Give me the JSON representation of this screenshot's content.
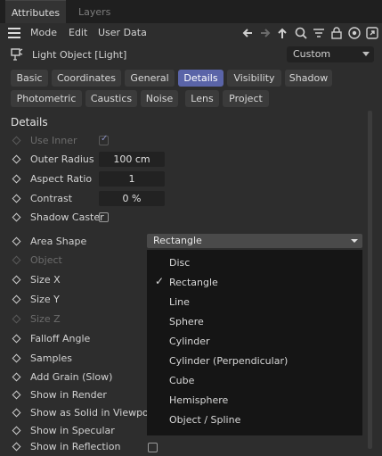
{
  "tabs": {
    "active": "Attributes",
    "inactive": "Layers"
  },
  "menu": {
    "mode": "Mode",
    "edit": "Edit",
    "user_data": "User Data"
  },
  "toolbar_icons": [
    "arrow-left-icon",
    "arrow-right-icon",
    "arrow-up-icon",
    "search-icon",
    "filter-icon",
    "lock-icon",
    "target-icon",
    "expand-icon"
  ],
  "object": {
    "title": "Light Object [Light]",
    "mode_value": "Custom"
  },
  "property_tabs": [
    "Basic",
    "Coordinates",
    "General",
    "Details",
    "Visibility",
    "Shadow",
    "Photometric",
    "Caustics",
    "Noise",
    "Lens",
    "Project"
  ],
  "active_tab": "Details",
  "section_title": "Details",
  "params": {
    "use_inner": "Use Inner",
    "outer_radius": "Outer Radius",
    "outer_radius_value": "100 cm",
    "aspect_ratio": "Aspect Ratio",
    "aspect_ratio_value": "1",
    "contrast": "Contrast",
    "contrast_value": "0 %",
    "shadow_caster": "Shadow Caster",
    "area_shape": "Area Shape",
    "object": "Object",
    "size_x": "Size X",
    "size_y": "Size Y",
    "size_z": "Size Z",
    "falloff_angle": "Falloff Angle",
    "samples": "Samples",
    "add_grain": "Add Grain (Slow)",
    "show_in_render": "Show in Render",
    "show_as_solid": "Show as Solid in Viewport",
    "show_in_specular": "Show in Specular",
    "show_in_reflection": "Show in Reflection"
  },
  "area_shape": {
    "selected": "Rectangle",
    "options": [
      "Disc",
      "Rectangle",
      "Line",
      "Sphere",
      "Cylinder",
      "Cylinder (Perpendicular)",
      "Cube",
      "Hemisphere",
      "Object / Spline"
    ]
  },
  "colors": {
    "accent": "#5a64a8",
    "background": "#2d2d2d",
    "popup": "#151515"
  }
}
